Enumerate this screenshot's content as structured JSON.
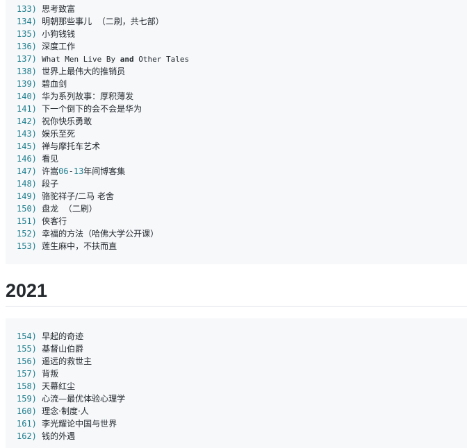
{
  "block1": {
    "items": [
      {
        "num": "133)",
        "text": "思考致富"
      },
      {
        "num": "134)",
        "text": "明朝那些事儿  （二刷，共七部）"
      },
      {
        "num": "135)",
        "text": "小狗钱钱"
      },
      {
        "num": "136)",
        "text": "深度工作"
      },
      {
        "num": "137)",
        "pre": "What Men Live By ",
        "kw": "and",
        "post": " Other Tales"
      },
      {
        "num": "138)",
        "text": "世界上最伟大的推销员"
      },
      {
        "num": "139)",
        "text": "碧血剑"
      },
      {
        "num": "140)",
        "text": "华为系列故事：厚积薄发"
      },
      {
        "num": "141)",
        "text": "下一个倒下的会不会是华为"
      },
      {
        "num": "142)",
        "text": "祝你快乐勇敢"
      },
      {
        "num": "143)",
        "text": "娱乐至死"
      },
      {
        "num": "145)",
        "text": "禅与摩托车艺术"
      },
      {
        "num": "146)",
        "text": "看见"
      },
      {
        "num": "147)",
        "a": "许嵩",
        "b": "06",
        "c": "-",
        "d": "13",
        "e": "年间博客集"
      },
      {
        "num": "148)",
        "text": "段子"
      },
      {
        "num": "149)",
        "text": "骆驼祥子/二马 老舍"
      },
      {
        "num": "150)",
        "text": "盘龙  （二刷）"
      },
      {
        "num": "151)",
        "text": "侠客行"
      },
      {
        "num": "152)",
        "text": "幸福的方法（哈佛大学公开课）"
      },
      {
        "num": "153)",
        "text": "莲生麻中，不扶而直"
      }
    ]
  },
  "heading": "2021",
  "block2": {
    "items": [
      {
        "num": "154)",
        "text": "早起的奇迹"
      },
      {
        "num": "155)",
        "text": "基督山伯爵"
      },
      {
        "num": "156)",
        "text": "遥远的救世主"
      },
      {
        "num": "157)",
        "text": "背叛"
      },
      {
        "num": "158)",
        "text": "天幕红尘"
      },
      {
        "num": "159)",
        "text": "心流—最优体验心理学"
      },
      {
        "num": "160)",
        "text": "理念·制度·人"
      },
      {
        "num": "161)",
        "text": "李光耀论中国与世界"
      },
      {
        "num": "162)",
        "text": "钱的外遇"
      }
    ]
  }
}
